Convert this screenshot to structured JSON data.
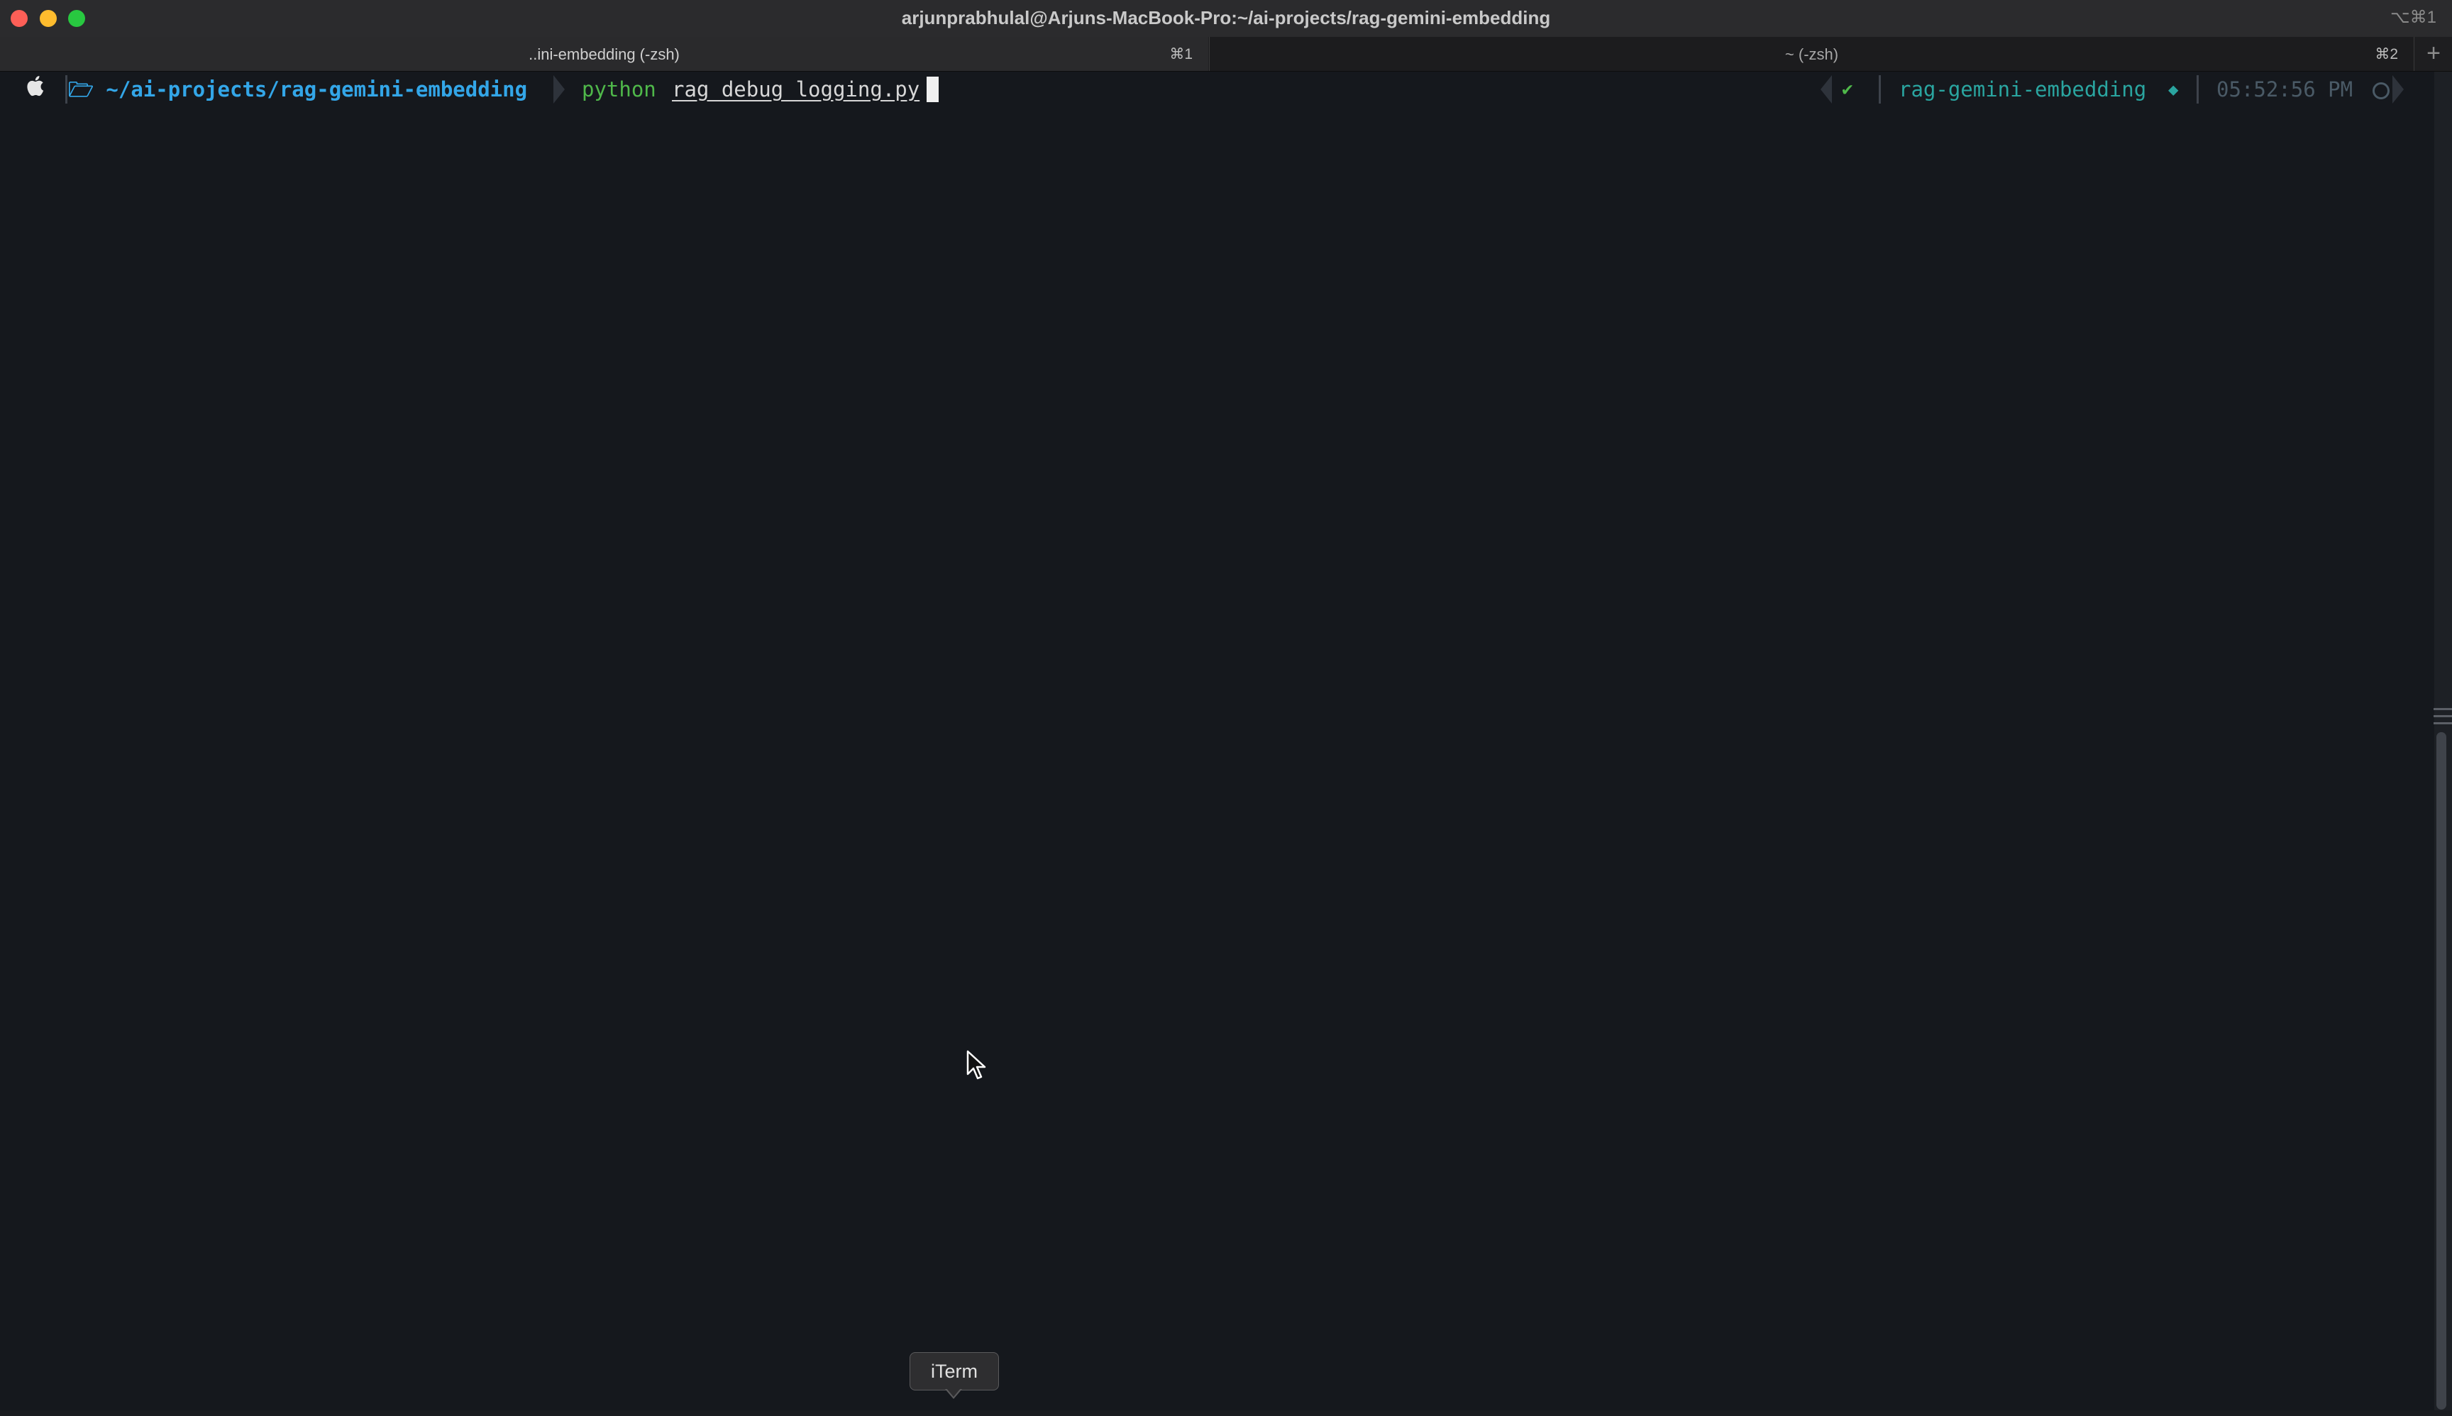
{
  "window": {
    "title": "arjunprabhulal@Arjuns-MacBook-Pro:~/ai-projects/rag-gemini-embedding",
    "title_shortcut": "⌥⌘1"
  },
  "tabs": [
    {
      "label": "..ini-embedding (-zsh)",
      "shortcut": "⌘1",
      "active": true
    },
    {
      "label": "~ (-zsh)",
      "shortcut": "⌘2",
      "active": false
    }
  ],
  "new_tab_label": "+",
  "prompt": {
    "os_icon": "apple-icon",
    "directory": "🗁 ~/ai-projects/rag-gemini-embedding",
    "command": "python",
    "argument": "rag_debug_logging.py"
  },
  "right_prompt": {
    "status": "✔",
    "env": "rag-gemini-embedding",
    "env_icon": "diamond-icon",
    "time": "05:52:56 PM",
    "time_icon": "clock-icon"
  },
  "tooltip": {
    "text": "iTerm"
  },
  "colors": {
    "directory": "#33a6e8",
    "command": "#4fb84a",
    "env": "#2aa5a0",
    "time": "#4a5a66",
    "background": "#15181d"
  }
}
